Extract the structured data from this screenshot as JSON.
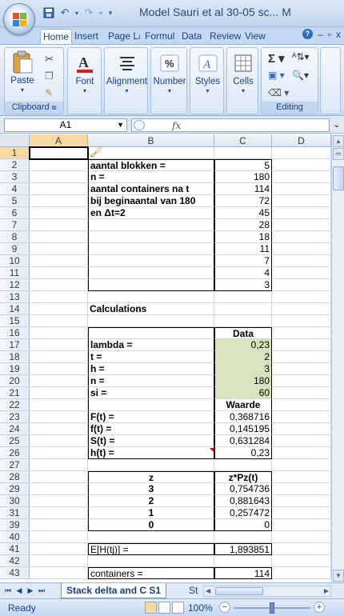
{
  "window": {
    "title": "Model Sauri et al 30-05 sc... M",
    "controls": [
      "–",
      "□",
      "x"
    ]
  },
  "tabs": [
    {
      "label": "Home",
      "active": true
    },
    {
      "label": "Insert"
    },
    {
      "label": "Page La"
    },
    {
      "label": "Formul"
    },
    {
      "label": "Data"
    },
    {
      "label": "Review"
    },
    {
      "label": "View"
    }
  ],
  "ribbon": {
    "clipboard": {
      "paste": "Paste",
      "group": "Clipboard"
    },
    "font": "Font",
    "alignment": "Alignment",
    "number": "Number",
    "styles": "Styles",
    "cells": "Cells",
    "editing": "Editing"
  },
  "formula_bar": {
    "name_box": "A1",
    "fx": "fx",
    "content": ""
  },
  "columns": [
    "A",
    "B",
    "C",
    "D"
  ],
  "rows": [
    {
      "n": "1"
    },
    {
      "n": "2",
      "b": "aantal blokken =",
      "c": "5"
    },
    {
      "n": "3",
      "b": "n =",
      "c": "180"
    },
    {
      "n": "4",
      "b": "aantal containers na t",
      "c": "114"
    },
    {
      "n": "5",
      "b": "bij beginaantal van 180",
      "c": "72"
    },
    {
      "n": "6",
      "b": "en Δt=2",
      "c": "45"
    },
    {
      "n": "7",
      "c": "28"
    },
    {
      "n": "8",
      "c": "18"
    },
    {
      "n": "9",
      "c": "11"
    },
    {
      "n": "10",
      "c": "7"
    },
    {
      "n": "11",
      "c": "4"
    },
    {
      "n": "12",
      "c": "3"
    },
    {
      "n": "13"
    },
    {
      "n": "14",
      "b": "Calculations"
    },
    {
      "n": "15"
    },
    {
      "n": "16",
      "c": "Data"
    },
    {
      "n": "17",
      "b": "lambda =",
      "c": "0,23"
    },
    {
      "n": "18",
      "b": "t =",
      "c": "2"
    },
    {
      "n": "19",
      "b": "h =",
      "c": "3"
    },
    {
      "n": "20",
      "b": "n =",
      "c": "180"
    },
    {
      "n": "21",
      "b": "si =",
      "c": "60"
    },
    {
      "n": "22",
      "c": "Waarde"
    },
    {
      "n": "23",
      "b": "F(t) =",
      "c": "0,368716"
    },
    {
      "n": "24",
      "b": "f(t) =",
      "c": "0,145195"
    },
    {
      "n": "25",
      "b": "S(t) =",
      "c": "0,631284"
    },
    {
      "n": "26",
      "b": "h(t) =",
      "c": "0,23"
    },
    {
      "n": "27"
    },
    {
      "n": "28",
      "b": "z",
      "c": "z*Pz(t)"
    },
    {
      "n": "29",
      "b": "3",
      "c": "0,754736"
    },
    {
      "n": "30",
      "b": "2",
      "c": "0,881643"
    },
    {
      "n": "31",
      "b": "1",
      "c": "0,257472"
    },
    {
      "n": "39",
      "b": "0",
      "c": "0"
    },
    {
      "n": "40"
    },
    {
      "n": "41",
      "b": "E[H(tj)] =",
      "c": "1,893851"
    },
    {
      "n": "42"
    },
    {
      "n": "43",
      "b": "containers =",
      "c": "114"
    }
  ],
  "sheets": {
    "active": "Stack delta and C S1",
    "next": "St"
  },
  "status": {
    "text": "Ready",
    "zoom": "100%"
  }
}
